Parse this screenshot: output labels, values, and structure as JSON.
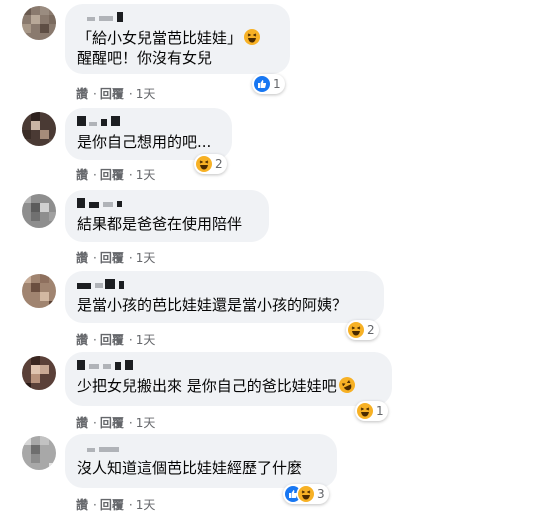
{
  "comments": [
    {
      "lines": [
        "「給小女兒當芭比娃娃」",
        "醒醒吧！你沒有女兒"
      ],
      "actions": {
        "like": "讚",
        "reply": "回覆",
        "time": "1天"
      },
      "reactions": {
        "types": [
          "like-icon"
        ],
        "count": "1"
      },
      "inline_emoji": "haha"
    },
    {
      "lines": [
        "是你自己想用的吧..."
      ],
      "actions": {
        "like": "讚",
        "reply": "回覆",
        "time": "1天"
      },
      "reactions": {
        "types": [
          "haha-icon"
        ],
        "count": "2"
      }
    },
    {
      "lines": [
        "結果都是爸爸在使用陪伴"
      ],
      "actions": {
        "like": "讚",
        "reply": "回覆",
        "time": "1天"
      }
    },
    {
      "lines": [
        "是當小孩的芭比娃娃還是當小孩的阿姨？"
      ],
      "actions": {
        "like": "讚",
        "reply": "回覆",
        "time": "1天"
      },
      "reactions": {
        "types": [
          "haha-icon"
        ],
        "count": "2"
      }
    },
    {
      "lines": [
        "少把女兒搬出來 是你自己的爸比娃娃吧"
      ],
      "actions": {
        "like": "讚",
        "reply": "回覆",
        "time": "1天"
      },
      "reactions": {
        "types": [
          "haha-icon"
        ],
        "count": "1"
      },
      "inline_emoji": "rofl"
    },
    {
      "lines": [
        "沒人知道這個芭比娃娃經歷了什麼"
      ],
      "actions": {
        "like": "讚",
        "reply": "回覆",
        "time": "1天"
      },
      "reactions": {
        "types": [
          "like-icon",
          "haha-icon"
        ],
        "count": "3"
      }
    }
  ],
  "colors": {
    "bubble": "#f0f2f5",
    "like": "#1877f2",
    "haha": "#f7b125",
    "meta": "#65676b"
  }
}
